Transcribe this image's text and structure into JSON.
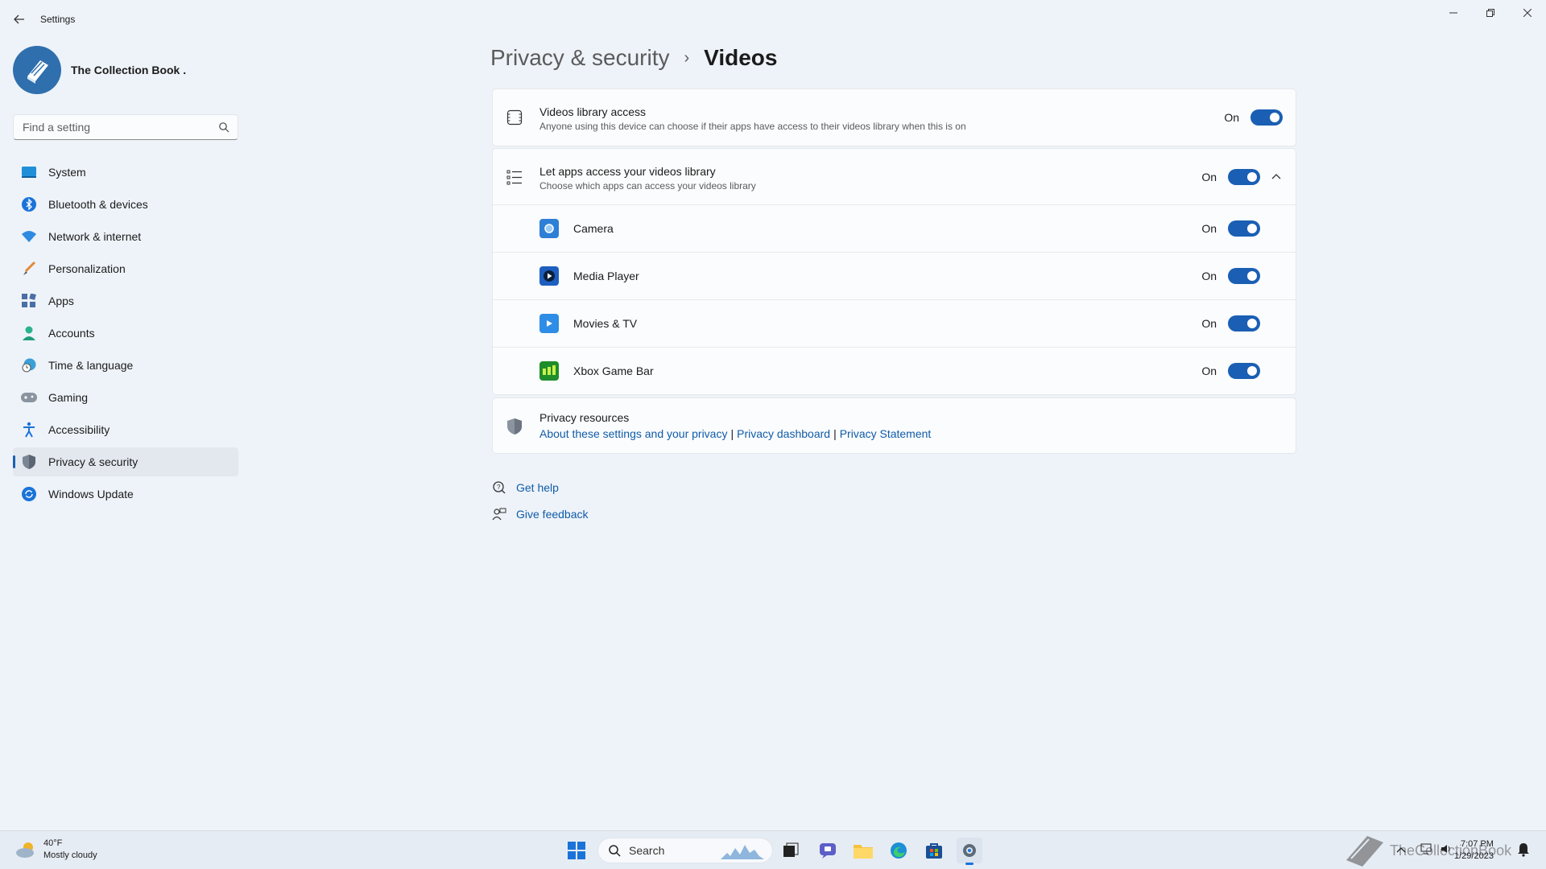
{
  "window": {
    "title": "Settings"
  },
  "profile": {
    "name": "The Collection Book ."
  },
  "search": {
    "placeholder": "Find a setting"
  },
  "sidebar": {
    "items": [
      {
        "label": "System",
        "icon": "system-icon"
      },
      {
        "label": "Bluetooth & devices",
        "icon": "bluetooth-icon"
      },
      {
        "label": "Network & internet",
        "icon": "wifi-icon"
      },
      {
        "label": "Personalization",
        "icon": "brush-icon"
      },
      {
        "label": "Apps",
        "icon": "apps-icon"
      },
      {
        "label": "Accounts",
        "icon": "person-icon"
      },
      {
        "label": "Time & language",
        "icon": "globe-clock-icon"
      },
      {
        "label": "Gaming",
        "icon": "gamepad-icon"
      },
      {
        "label": "Accessibility",
        "icon": "accessibility-icon"
      },
      {
        "label": "Privacy & security",
        "icon": "shield-icon"
      },
      {
        "label": "Windows Update",
        "icon": "update-icon"
      }
    ],
    "active_index": 9
  },
  "breadcrumb": {
    "parent": "Privacy & security",
    "separator": "›",
    "current": "Videos"
  },
  "library_access": {
    "title": "Videos library access",
    "description": "Anyone using this device can choose if their apps have access to their videos library when this is on",
    "state_label": "On",
    "enabled": true
  },
  "apps_access": {
    "title": "Let apps access your videos library",
    "description": "Choose which apps can access your videos library",
    "state_label": "On",
    "enabled": true,
    "expanded": true,
    "apps": [
      {
        "name": "Camera",
        "state_label": "On",
        "enabled": true,
        "icon": "camera-app-icon"
      },
      {
        "name": "Media Player",
        "state_label": "On",
        "enabled": true,
        "icon": "media-player-app-icon"
      },
      {
        "name": "Movies & TV",
        "state_label": "On",
        "enabled": true,
        "icon": "movies-tv-app-icon"
      },
      {
        "name": "Xbox Game Bar",
        "state_label": "On",
        "enabled": true,
        "icon": "xbox-game-bar-app-icon"
      }
    ]
  },
  "privacy_resources": {
    "title": "Privacy resources",
    "links": {
      "about": "About these settings and your privacy",
      "dashboard": "Privacy dashboard",
      "statement": "Privacy Statement"
    },
    "separator": "|"
  },
  "help": {
    "get_help": "Get help",
    "give_feedback": "Give feedback"
  },
  "taskbar": {
    "weather_temp": "40°F",
    "weather_desc": "Mostly cloudy",
    "search_label": "Search",
    "time": "7:07 PM",
    "date": "1/29/2023",
    "watermark": "TheCollectionBook"
  },
  "colors": {
    "accent": "#1a5fb4",
    "link": "#0f5ca8",
    "background": "#eef3f9",
    "card": "#fbfcfd"
  }
}
